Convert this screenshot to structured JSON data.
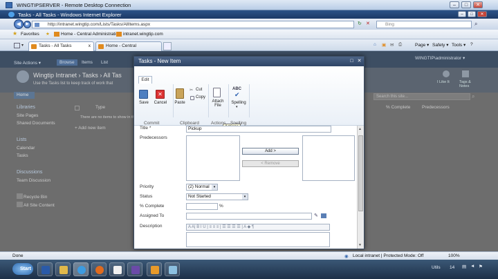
{
  "rdp": {
    "title": "WINGTIPSERVER - Remote Desktop Connection",
    "min": "–",
    "max": "□",
    "close": "✕"
  },
  "ie": {
    "title": "Tasks - All Tasks - Windows Internet Explorer",
    "min": "–",
    "max": "□",
    "close": "✕",
    "back": "◀",
    "forward": "▶",
    "address": "http://intranet.wingtip.com/Lists/Tasks/AllItems.aspx",
    "search_placeholder": "Bing",
    "favorites_label": "Favorites",
    "fav_items": [
      "Home - Central Administration",
      "intranet.wingtip.com"
    ],
    "tabs": [
      {
        "label": "Tasks - All Tasks",
        "close": "x"
      },
      {
        "label": "Home - Central Administration"
      }
    ],
    "cmd_items": [
      "Page ▾",
      "Safety ▾",
      "Tools ▾",
      "?"
    ]
  },
  "sp": {
    "top_items": [
      "Site Actions ▾",
      "Browse",
      "Items",
      "List"
    ],
    "user": "WINGTIP\\administrator ▾",
    "breadcrumb": "Wingtip Intranet › Tasks › All Tas",
    "desc": "Use the Tasks list to keep track of work that",
    "right_icons": [
      "I Like It",
      "Tags & Notes"
    ],
    "home": "Home",
    "search_placeholder": "Search this site...",
    "sidebar": {
      "libraries": "Libraries",
      "site_pages": "Site Pages",
      "shared_docs": "Shared Documents",
      "lists": "Lists",
      "calendar": "Calendar",
      "tasks": "Tasks",
      "discussions": "Discussions",
      "team_discussion": "Team Discussion",
      "recycle": "Recycle Bin",
      "all_content": "All Site Content"
    },
    "columns": [
      "Type",
      "% Complete",
      "Predecessors"
    ],
    "empty_msg": "There are no items to show in this",
    "add_item": "+ Add new item"
  },
  "dialog": {
    "title": "Tasks - New Item",
    "max": "□",
    "close": "✕",
    "tab_edit": "Edit",
    "ribbon": {
      "save": "Save",
      "cancel": "Cancel",
      "paste": "Paste",
      "cut": "Cut",
      "copy": "Copy",
      "attach": "Attach File",
      "spelling": "Spelling",
      "abc": "ABC",
      "groups": [
        "Commit",
        "Clipboard",
        "Actions",
        "Spelling"
      ],
      "tooltip": "Actions"
    },
    "form": {
      "title_label": "Title *",
      "title_value": "Pickup",
      "predecessors_label": "Predecessors",
      "add_btn": "Add >",
      "remove_btn": "< Remove",
      "priority_label": "Priority",
      "priority_value": "(2) Normal",
      "status_label": "Status",
      "status_value": "Not Started",
      "pct_label": "% Complete",
      "pct_suffix": "%",
      "assigned_label": "Assigned To",
      "description_label": "Description",
      "toolbar": "A  A|  B  I  U  |  ≡  ≡  ≡  |  ☰  ☰  ☰  ☰  |  A  ◆  ¶"
    }
  },
  "status": {
    "left": "Done",
    "zone": "Local intranet | Protected Mode: Off",
    "zoom": "100%"
  },
  "taskbar": {
    "start": "Start",
    "utils": "Utils",
    "time": "14"
  }
}
